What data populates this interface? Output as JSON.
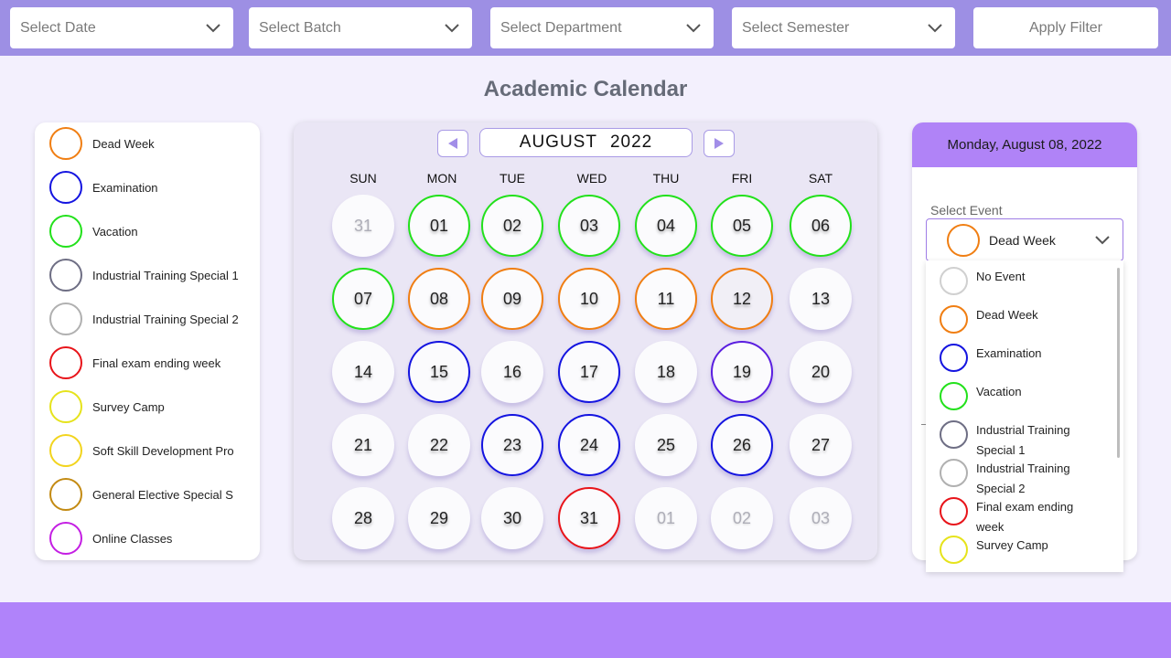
{
  "filters": {
    "date": "Select Date",
    "batch": "Select Batch",
    "department": "Select Department",
    "semester": "Select Semester",
    "apply": "Apply Filter"
  },
  "page_title": "Academic Calendar",
  "legend": [
    {
      "label": "Dead Week",
      "color": "#f07e12"
    },
    {
      "label": "Examination",
      "color": "#1414e0"
    },
    {
      "label": "Vacation",
      "color": "#22e11b"
    },
    {
      "label": "Industrial Training Special 1",
      "color": "#6e6e84"
    },
    {
      "label": "Industrial Training Special 2",
      "color": "#b0b0b0"
    },
    {
      "label": "Final exam ending week",
      "color": "#e8141a"
    },
    {
      "label": "Survey Camp",
      "color": "#e6e31c"
    },
    {
      "label": "Soft Skill Development Pro",
      "color": "#f2d41e"
    },
    {
      "label": "General Elective Special S",
      "color": "#c38a12"
    },
    {
      "label": "Online Classes",
      "color": "#c41ee3"
    }
  ],
  "calendar": {
    "month": "AUGUST",
    "year": "2022",
    "weekdays": [
      "SUN",
      "MON",
      "TUE",
      "WED",
      "THU",
      "FRI",
      "SAT"
    ],
    "days": [
      {
        "label": "31",
        "muted": true,
        "color": ""
      },
      {
        "label": "01",
        "muted": false,
        "color": "#22e11b"
      },
      {
        "label": "02",
        "muted": false,
        "color": "#22e11b"
      },
      {
        "label": "03",
        "muted": false,
        "color": "#22e11b"
      },
      {
        "label": "04",
        "muted": false,
        "color": "#22e11b"
      },
      {
        "label": "05",
        "muted": false,
        "color": "#22e11b"
      },
      {
        "label": "06",
        "muted": false,
        "color": "#22e11b"
      },
      {
        "label": "07",
        "muted": false,
        "color": "#22e11b"
      },
      {
        "label": "08",
        "muted": false,
        "color": "#f07e12"
      },
      {
        "label": "09",
        "muted": false,
        "color": "#f07e12"
      },
      {
        "label": "10",
        "muted": false,
        "color": "#f07e12"
      },
      {
        "label": "11",
        "muted": false,
        "color": "#f07e12"
      },
      {
        "label": "12",
        "muted": false,
        "color": "#f07e12",
        "selected": true
      },
      {
        "label": "13",
        "muted": false,
        "color": ""
      },
      {
        "label": "14",
        "muted": false,
        "color": ""
      },
      {
        "label": "15",
        "muted": false,
        "color": "#1414e0"
      },
      {
        "label": "16",
        "muted": false,
        "color": ""
      },
      {
        "label": "17",
        "muted": false,
        "color": "#1414e0"
      },
      {
        "label": "18",
        "muted": false,
        "color": ""
      },
      {
        "label": "19",
        "muted": false,
        "color": "#5a1ee0"
      },
      {
        "label": "20",
        "muted": false,
        "color": ""
      },
      {
        "label": "21",
        "muted": false,
        "color": ""
      },
      {
        "label": "22",
        "muted": false,
        "color": ""
      },
      {
        "label": "23",
        "muted": false,
        "color": "#1414e0"
      },
      {
        "label": "24",
        "muted": false,
        "color": "#1414e0"
      },
      {
        "label": "25",
        "muted": false,
        "color": ""
      },
      {
        "label": "26",
        "muted": false,
        "color": "#1414e0"
      },
      {
        "label": "27",
        "muted": false,
        "color": ""
      },
      {
        "label": "28",
        "muted": false,
        "color": ""
      },
      {
        "label": "29",
        "muted": false,
        "color": ""
      },
      {
        "label": "30",
        "muted": false,
        "color": ""
      },
      {
        "label": "31",
        "muted": false,
        "color": "#e8141a"
      },
      {
        "label": "01",
        "muted": true,
        "color": ""
      },
      {
        "label": "02",
        "muted": true,
        "color": ""
      },
      {
        "label": "03",
        "muted": true,
        "color": ""
      }
    ]
  },
  "detail": {
    "date_heading": "Monday, August 08, 2022",
    "select_label": "Select Event",
    "selected_event": "Dead Week",
    "selected_color": "#f07e12",
    "options": [
      {
        "label": "No Event",
        "color": "#d0d0d0"
      },
      {
        "label": "Dead Week",
        "color": "#f07e12"
      },
      {
        "label": "Examination",
        "color": "#1414e0"
      },
      {
        "label": "Vacation",
        "color": "#22e11b"
      },
      {
        "label": "Industrial Training Special 1",
        "color": "#6e6e84"
      },
      {
        "label": "Industrial Training Special 2",
        "color": "#b0b0b0"
      },
      {
        "label": "Final exam ending week",
        "color": "#e8141a"
      },
      {
        "label": "Survey Camp",
        "color": "#e6e31c"
      }
    ]
  }
}
